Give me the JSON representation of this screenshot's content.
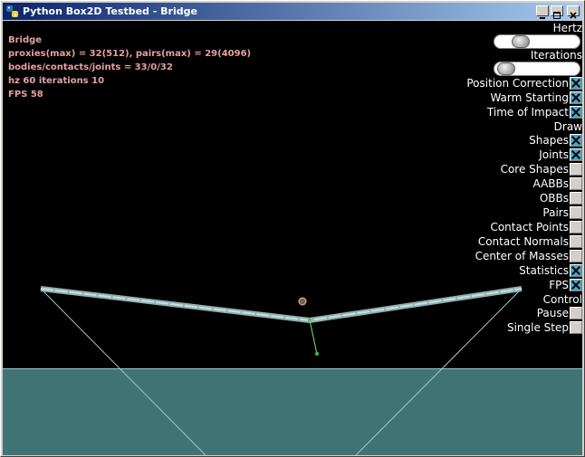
{
  "window": {
    "title": "Python Box2D Testbed - Bridge",
    "buttons": [
      "minimize",
      "maximize",
      "close"
    ]
  },
  "stats": {
    "test_name": "Bridge",
    "proxies": "proxies(max) = 32(512), pairs(max) = 29(4096)",
    "bodies": "bodies/contacts/joints = 33/0/32",
    "hz_iterations": "hz 60 iterations 10",
    "fps": "FPS 58"
  },
  "panel": {
    "hertz_label": "Hertz",
    "hertz_value": 60,
    "iterations_label": "Iterations",
    "iterations_value": 10,
    "options": [
      {
        "label": "Position Correction",
        "checked": true
      },
      {
        "label": "Warm Starting",
        "checked": true
      },
      {
        "label": "Time of Impact",
        "checked": true
      }
    ],
    "draw_label": "Draw",
    "draw_options": [
      {
        "label": "Shapes",
        "checked": true
      },
      {
        "label": "Joints",
        "checked": true
      },
      {
        "label": "Core Shapes",
        "checked": false
      },
      {
        "label": "AABBs",
        "checked": false
      },
      {
        "label": "OBBs",
        "checked": false
      },
      {
        "label": "Pairs",
        "checked": false
      },
      {
        "label": "Contact Points",
        "checked": false
      },
      {
        "label": "Contact Normals",
        "checked": false
      },
      {
        "label": "Center of Masses",
        "checked": false
      },
      {
        "label": "Statistics",
        "checked": true
      },
      {
        "label": "FPS",
        "checked": true
      }
    ],
    "control_label": "Control",
    "control_options": [
      {
        "label": "Pause",
        "checked": false
      },
      {
        "label": "Single Step",
        "checked": false
      }
    ]
  },
  "colors": {
    "background": "#000000",
    "ground": "#407474",
    "stats_text": "#e6a0a0",
    "bridge": "#b8d8d8"
  }
}
